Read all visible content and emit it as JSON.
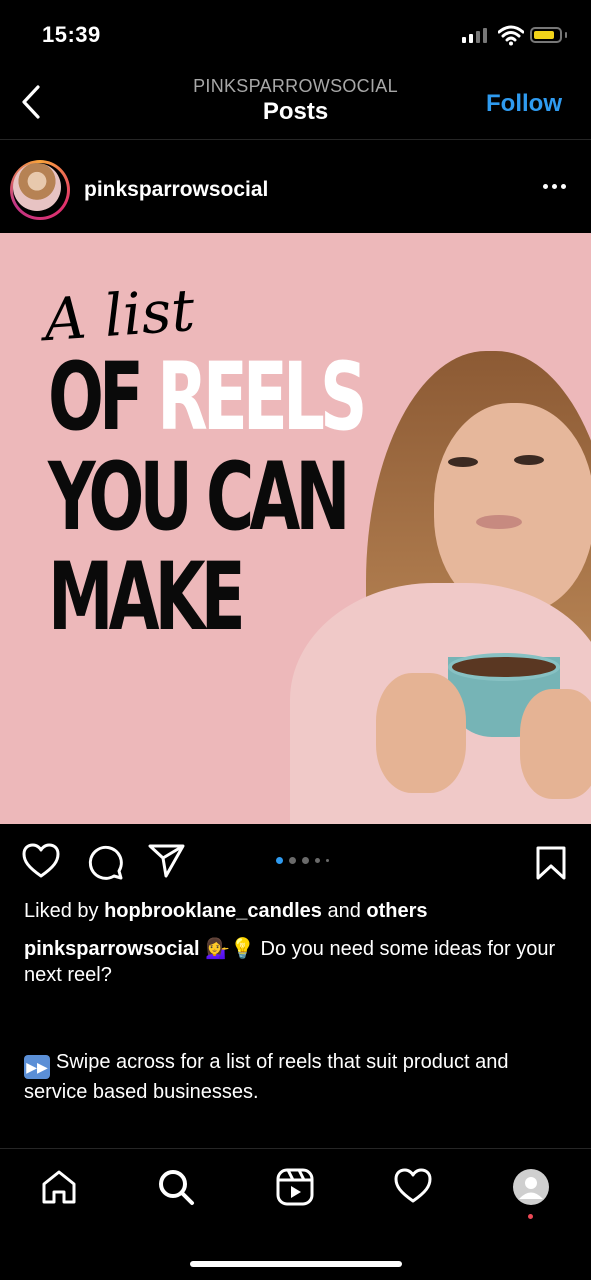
{
  "status_bar": {
    "time": "15:39",
    "battery_level": 0.85
  },
  "header": {
    "account": "PINKSPARROWSOCIAL",
    "title": "Posts",
    "follow_label": "Follow"
  },
  "post": {
    "username": "pinksparrowsocial",
    "image": {
      "script_text": "A list",
      "line1_black": "OF",
      "line1_white": "REELS",
      "line2": "YOU CAN",
      "line3": "MAKE"
    },
    "carousel": {
      "count": 5,
      "active_index": 0
    },
    "likes": {
      "prefix": "Liked by ",
      "user": "hopbrooklane_candles",
      "middle": " and ",
      "others": "others"
    },
    "caption": {
      "username": "pinksparrowsocial",
      "emojis": "💁‍♀️💡",
      "text": " Do you need some ideas for your next reel?"
    },
    "caption2": {
      "emoji": "⏩",
      "text": "Swipe across for a list of reels that suit product and service based businesses."
    }
  },
  "tabs": [
    "home-icon",
    "search-icon",
    "reels-icon",
    "activity-icon",
    "profile-icon"
  ],
  "colors": {
    "accent": "#2f9bf0",
    "bg": "#000000",
    "image_bg": "#edb8ba",
    "battery": "#f2d41a",
    "notification": "#ed4956"
  }
}
